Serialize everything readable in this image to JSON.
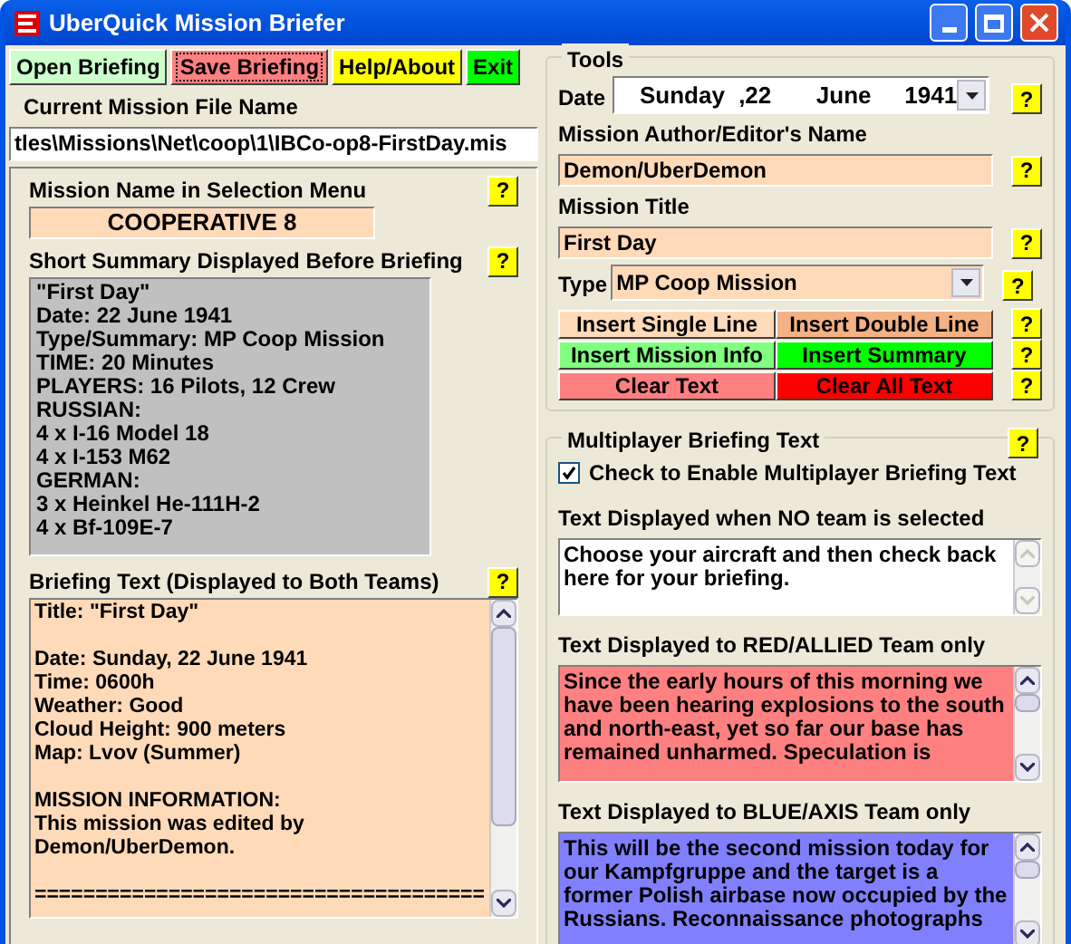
{
  "window": {
    "title": "UberQuick Mission Briefer"
  },
  "menu": [
    {
      "label": "Open Briefing",
      "color": "#ccffcc",
      "focused": false
    },
    {
      "label": "Save Briefing",
      "color": "#ff8080",
      "focused": true
    },
    {
      "label": "Help/About",
      "color": "#ffff00",
      "focused": false
    },
    {
      "label": "Exit",
      "color": "#00ff00",
      "focused": false
    }
  ],
  "file": {
    "label": "Current Mission File Name",
    "value": "tles\\Missions\\Net\\coop\\1\\IBCo-op8-FirstDay.mis"
  },
  "mission_name": {
    "label": "Mission Name in Selection Menu",
    "value": "COOPERATIVE 8",
    "help": "?"
  },
  "summary": {
    "label": "Short Summary Displayed Before Briefing",
    "help": "?",
    "lines": [
      "\"First Day\"",
      "Date: 22 June 1941",
      "Type/Summary: MP Coop Mission",
      "TIME: 20 Minutes",
      "PLAYERS: 16 Pilots, 12 Crew",
      "RUSSIAN:",
      "4 x I-16 Model 18",
      "4 x I-153 M62",
      "GERMAN:",
      "3 x Heinkel He-111H-2",
      "4 x Bf-109E-7"
    ]
  },
  "briefing": {
    "label": "Briefing Text (Displayed to Both Teams)",
    "help": "?",
    "paragraphs": [
      [
        "Title: \"First Day\""
      ],
      [
        "Date: Sunday, 22 June 1941",
        "Time: 0600h",
        "Weather: Good",
        "Cloud Height: 900 meters",
        "Map: Lvov (Summer)"
      ],
      [
        "MISSION INFORMATION:",
        "This mission was edited by",
        "Demon/UberDemon."
      ],
      [
        "====================================="
      ]
    ]
  },
  "tools": {
    "title": "Tools",
    "date": {
      "label": "Date",
      "weekday": "Sunday",
      "day": ",22",
      "month": "June",
      "year": "1941",
      "help": "?"
    },
    "author": {
      "label": "Mission Author/Editor's Name",
      "value": "Demon/UberDemon",
      "help": "?"
    },
    "mission_title": {
      "label": "Mission Title",
      "value": "First Day",
      "help": "?"
    },
    "type": {
      "label": "Type",
      "value": "MP Coop Mission",
      "help": "?"
    },
    "button_rows": [
      {
        "help": "?",
        "buttons": [
          {
            "label": "Insert Single Line",
            "color": "#ffdab9"
          },
          {
            "label": "Insert Double Line",
            "color": "#f4b183"
          }
        ]
      },
      {
        "help": "?",
        "buttons": [
          {
            "label": "Insert Mission Info",
            "color": "#80ff80"
          },
          {
            "label": "Insert Summary",
            "color": "#00ff00"
          }
        ]
      },
      {
        "help": "?",
        "buttons": [
          {
            "label": "Clear Text",
            "color": "#ff8080"
          },
          {
            "label": "Clear All Text",
            "color": "#ff0000"
          }
        ]
      }
    ]
  },
  "multiplayer": {
    "title": "Multiplayer Briefing Text",
    "help": "?",
    "enable": {
      "label": "Check to Enable Multiplayer Briefing Text",
      "checked": true
    },
    "texts": [
      {
        "label": "Text Displayed when NO team is selected",
        "color": "#ffffff",
        "scroll_enabled": false,
        "lines": [
          "Choose your aircraft and then check back",
          "here for your briefing."
        ]
      },
      {
        "label": "Text Displayed to RED/ALLIED Team only",
        "color": "#ff8080",
        "scroll_enabled": true,
        "lines": [
          "Since the early hours of this morning we",
          "have been hearing explosions to the south",
          "and north-east, yet so far our base has",
          "remained unharmed. Speculation is"
        ]
      },
      {
        "label": "Text Displayed to BLUE/AXIS Team only",
        "color": "#8080ff",
        "scroll_enabled": true,
        "lines": [
          "This will be the second mission today for",
          "our Kampfgruppe and the target is a",
          "former Polish airbase now occupied by the",
          "Russians. Reconnaissance photographs"
        ]
      }
    ]
  }
}
